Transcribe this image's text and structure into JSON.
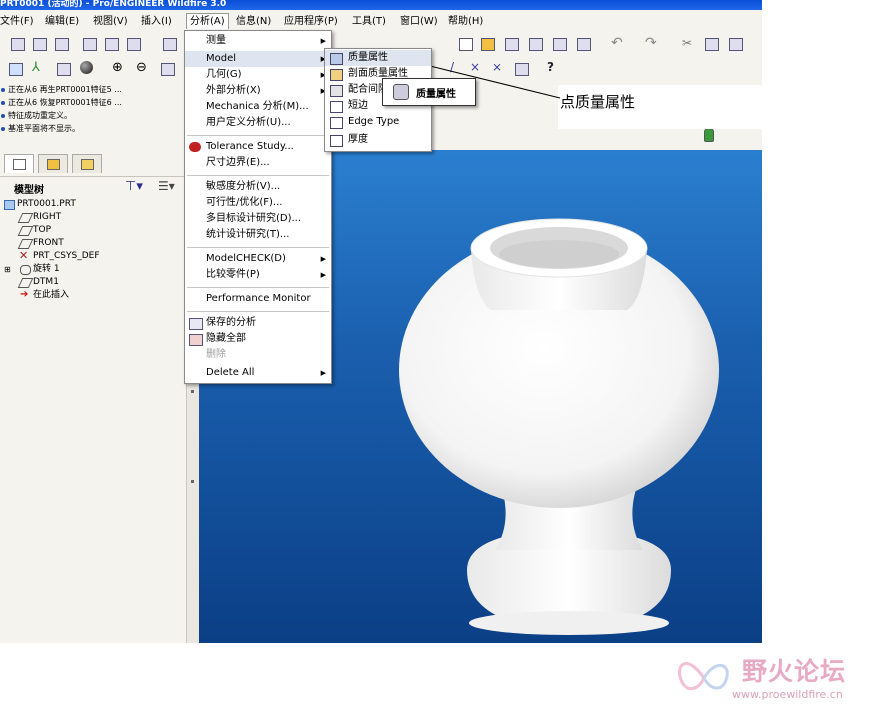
{
  "window": {
    "title": "PRT0001 (活动的) - Pro/ENGINEER Wildfire 3.0"
  },
  "menubar": {
    "items": [
      "文件(F)",
      "编辑(E)",
      "视图(V)",
      "插入(I)",
      "分析(A)",
      "信息(N)",
      "应用程序(P)",
      "工具(T)",
      "窗口(W)",
      "帮助(H)"
    ],
    "active": "分析(A)"
  },
  "messages": [
    "正在从6 再生PRT0001特征5 ...",
    "正在从6 恢复PRT0001特征6 ...",
    "特征成功重定义。",
    "基准平面将不显示。"
  ],
  "model_tree": {
    "header": "模型树",
    "nodes": [
      {
        "label": "PRT0001.PRT",
        "icon": "part-icon"
      },
      {
        "label": "RIGHT",
        "icon": "datum-plane-icon"
      },
      {
        "label": "TOP",
        "icon": "datum-plane-icon"
      },
      {
        "label": "FRONT",
        "icon": "datum-plane-icon"
      },
      {
        "label": "PRT_CSYS_DEF",
        "icon": "csys-icon"
      },
      {
        "label": "旋转 1",
        "icon": "revolve-icon"
      },
      {
        "label": "DTM1",
        "icon": "datum-plane-icon"
      },
      {
        "label": "在此插入",
        "icon": "insert-arrow-icon"
      }
    ]
  },
  "analysis_menu": {
    "items": [
      {
        "label": "测量",
        "submenu": true
      },
      {
        "label": "Model",
        "submenu": true,
        "highlighted": true
      },
      {
        "label": "几何(G)",
        "submenu": true
      },
      {
        "label": "外部分析(X)",
        "submenu": true
      },
      {
        "label": "Mechanica 分析(M)...",
        "submenu": false
      },
      {
        "label": "用户定义分析(U)...",
        "submenu": false
      },
      {
        "label": "Tolerance Study...",
        "submenu": false,
        "icon": "tolerance-icon"
      },
      {
        "label": "尺寸边界(E)...",
        "submenu": false
      },
      {
        "label": "敏感度分析(V)...",
        "submenu": false
      },
      {
        "label": "可行性/优化(F)...",
        "submenu": false
      },
      {
        "label": "多目标设计研究(D)...",
        "submenu": false
      },
      {
        "label": "统计设计研究(T)...",
        "submenu": false
      },
      {
        "label": "ModelCHECK(D)",
        "submenu": true
      },
      {
        "label": "比较零件(P)",
        "submenu": true
      },
      {
        "label": "Performance Monitor",
        "submenu": false
      },
      {
        "label": "保存的分析",
        "submenu": false,
        "icon": "saved-analysis-icon"
      },
      {
        "label": "隐藏全部",
        "submenu": false,
        "icon": "hide-all-icon"
      },
      {
        "label": "删除",
        "submenu": false,
        "disabled": true
      },
      {
        "label": "Delete All",
        "submenu": true
      }
    ]
  },
  "model_submenu": {
    "items": [
      {
        "label": "质量属性",
        "icon": "mass-props-icon",
        "highlighted": true
      },
      {
        "label": "剖面质量属性",
        "icon": "x-section-mass-icon"
      },
      {
        "label": "配合间隙",
        "icon": "clearance-icon"
      },
      {
        "label": "短边",
        "icon": "short-edge-icon"
      },
      {
        "label": "Edge Type",
        "icon": "edge-type-icon"
      },
      {
        "label": "厚度",
        "icon": "thickness-icon"
      }
    ]
  },
  "tooltip": {
    "label": "质量属性"
  },
  "callout": {
    "label": "点质量属性"
  },
  "watermark": {
    "title": "野火论坛",
    "url": "www.proewildfire.cn"
  },
  "colors": {
    "viewport_top": "#2b7fd0",
    "viewport_bottom": "#0b3f86",
    "model": "#ffffff",
    "titlebar": "#0a4fd6"
  }
}
